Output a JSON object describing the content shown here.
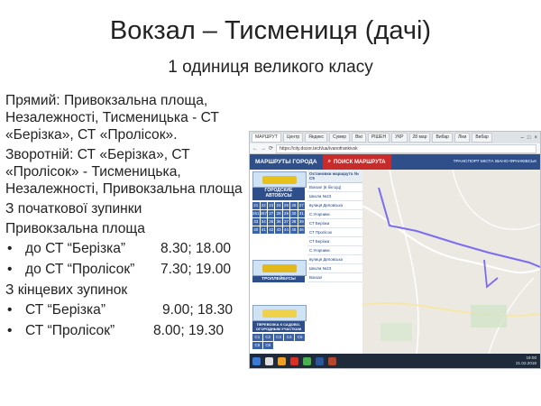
{
  "slide": {
    "title": "Вокзал – Тисмениця (дачі)",
    "subtitle": "1 одиниця великого класу",
    "forward": "Прямий: Привокзальна площа,  Незалежності, Тисменицька - СТ «Берізка», СТ «Пролісок».",
    "reverse": "Зворотній: СТ «Берізка», СТ «Пролісок» - Тисменицька, Незалежності, Привокзальна площа",
    "from_start_heading": "З початкової зупинки",
    "start_stop": "Привокзальна площа",
    "start_times": [
      {
        "stop": "до СТ “Берізка”",
        "times": "8.30; 18.00"
      },
      {
        "stop": "до СТ “Пролісок”",
        "times": "7.30; 19.00"
      }
    ],
    "from_end_heading": "З кінцевих зупинок",
    "end_times": [
      {
        "stop": "СТ “Берізка”",
        "times": "9.00; 18.30"
      },
      {
        "stop": "СТ “Пролісок”",
        "times": "8.00; 19.30"
      }
    ]
  },
  "screenshot": {
    "tabs": [
      "МАРШРУТ",
      "Центр",
      "Яндекс",
      "Сумер",
      "Вікі",
      "РІШЕН",
      "УКР",
      "28 мар",
      "Вибар",
      "Ліки",
      "Вибар"
    ],
    "url": "https://city.dozor.tech/ua/ivanofrankivsk",
    "header": {
      "brand": "МАРШРУТЫ ГОРОДА",
      "search_tab": "ПОИСК МАРШРУТА",
      "right_text": "ТРАНСПОРТ МІСТА ІВАНО-ФРАНКІВСЬК"
    },
    "sidebar": {
      "buses_heading": "ГОРОДСКИЕ АВТОБУСЫ",
      "bus_numbers": [
        "21",
        "22",
        "23",
        "24",
        "25",
        "26",
        "27",
        "261",
        "267",
        "27",
        "28",
        "29",
        "30",
        "31",
        "33",
        "34",
        "35",
        "36",
        "37",
        "38",
        "39",
        "40",
        "41",
        "42",
        "43",
        "44",
        "45",
        "46"
      ],
      "trolley_heading": "ТРОЛЛЕЙБУСЫ",
      "dacha_heading": "ПЕРЕВОЗКА К САДОВО-ОГОРОДНЫМ УЧАСТКАМ",
      "dacha_numbers": [
        "С1",
        "С2",
        "С3",
        "С4",
        "С5",
        "С6",
        "С8"
      ]
    },
    "route_list": {
      "heading": "Остановки маршрута № С5",
      "items": [
        "Вокзал (в бік ЦЦ)",
        "Школа №23",
        "вулиця Деповська",
        "С Угорники",
        "СТ Берізка",
        "СТ Пролісок",
        "СТ Берізка",
        "С Угорники",
        "вулиця Деповська",
        "Школа №23",
        "Вокзал"
      ]
    },
    "taskbar": {
      "time": "19:00",
      "date": "21.02.2018"
    },
    "colors": {
      "header": "#2e4f8a",
      "search_tab": "#c92a2a",
      "route_line": "#7b6cf0"
    }
  }
}
